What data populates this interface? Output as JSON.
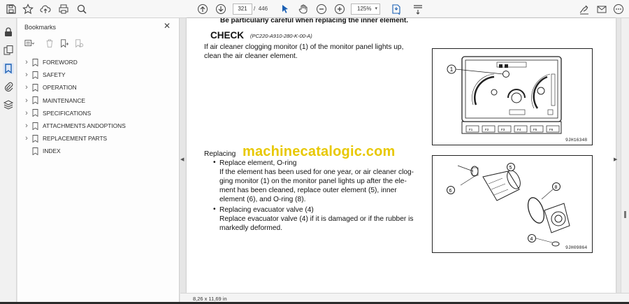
{
  "toolbar": {
    "current_page": "321",
    "page_separator": "/",
    "total_pages": "446",
    "zoom": "125%",
    "zoom_caret": "▾"
  },
  "bookmarks": {
    "title": "Bookmarks",
    "close_glyph": "✕",
    "items": [
      {
        "label": "FOREWORD",
        "expandable": true
      },
      {
        "label": "SAFETY",
        "expandable": true
      },
      {
        "label": "OPERATION",
        "expandable": true
      },
      {
        "label": "MAINTENANCE",
        "expandable": true
      },
      {
        "label": "SPECIFICATIONS",
        "expandable": true
      },
      {
        "label": "ATTACHMENTS ANDOPTIONS",
        "expandable": true
      },
      {
        "label": "REPLACEMENT PARTS",
        "expandable": true
      },
      {
        "label": "INDEX",
        "expandable": false
      }
    ]
  },
  "document": {
    "top_cut_text": "Be particularly careful when replacing the inner element.",
    "check_title": "CHECK",
    "check_code": "(PC220-A910-280-K-00-A)",
    "check_line1": "If air cleaner clogging monitor (1) of the monitor panel lights up,",
    "check_line2": "clean the air cleaner element.",
    "replacing_heading": "Replacing",
    "bullet_glyph": "•",
    "bullet1_title": "Replace element, O-ring",
    "bullet1_lines": [
      "If the element has been used for one year, or air cleaner clog-",
      "ging monitor (1) on the monitor panel lights up after the ele-",
      "ment has been cleaned, replace outer element (5), inner",
      "element (6), and O-ring (8)."
    ],
    "bullet2_title": "Replacing evacuator valve (4)",
    "bullet2_lines": [
      "Replace evacuator valve (4) if it is damaged or if the rubber is",
      "markedly deformed."
    ],
    "fig1_code": "9JH16348",
    "fig2_code": "9JH09864",
    "fig1_callout": "1",
    "fig1_buttons": [
      "F1",
      "F2",
      "F3",
      "F4",
      "F5",
      "F6"
    ],
    "fig2_callouts": {
      "c4": "4",
      "c5": "5",
      "c6": "6",
      "c8": "8"
    },
    "watermark": "machinecatalogic.com"
  },
  "status": {
    "page_size": "8,26 x 11,69 in"
  },
  "colors": {
    "watermark": "#e8c800",
    "active_rail": "#dde6f4",
    "select_tool": "#1a5fb4"
  },
  "icons": {
    "save": "save-icon",
    "bookmark": "star-icon",
    "upload": "cloud-upload-icon",
    "print": "print-icon",
    "search": "search-icon",
    "prev": "arrow-up-circle-icon",
    "next": "arrow-down-circle-icon",
    "select": "cursor-icon",
    "hand": "hand-icon",
    "zoom_out": "zoom-out-icon",
    "zoom_in": "zoom-in-icon",
    "fit": "fit-page-icon",
    "scroll_mode": "scroll-mode-icon",
    "sign": "sign-icon",
    "email": "email-icon",
    "more": "more-icon"
  }
}
